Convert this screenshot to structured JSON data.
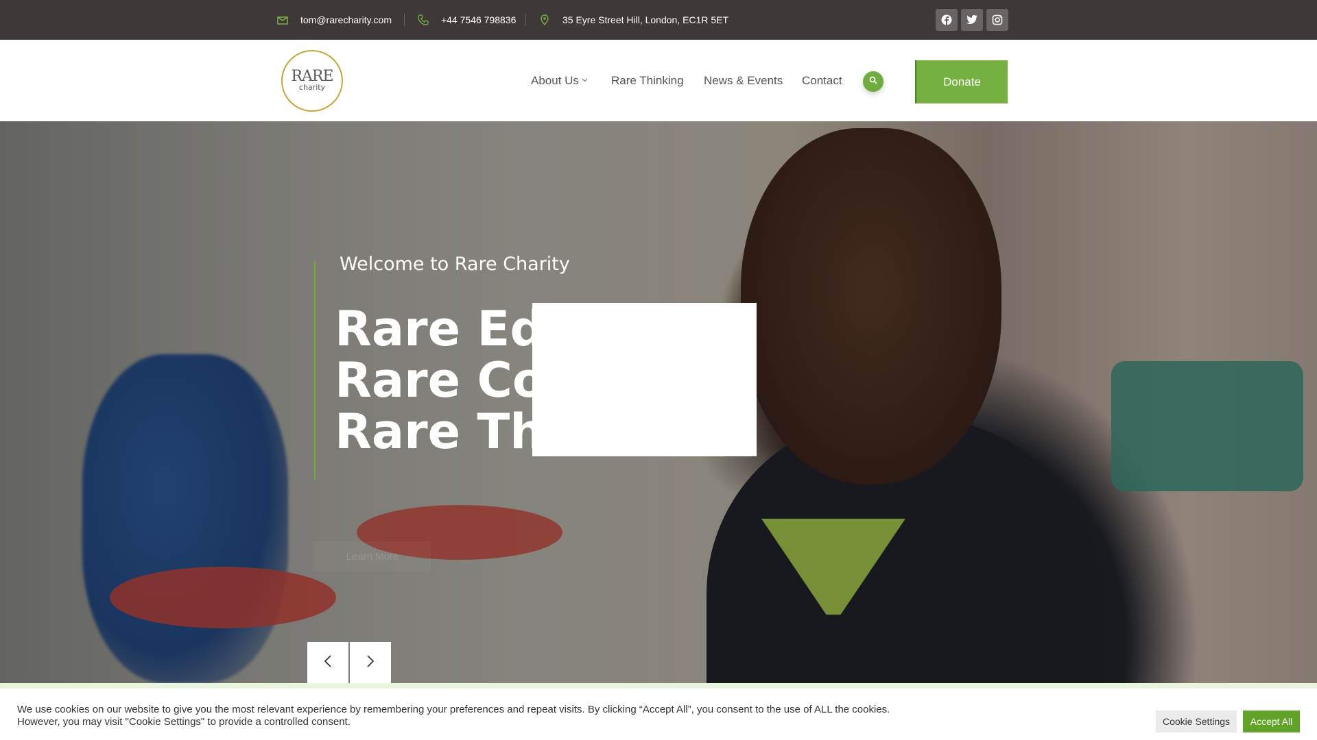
{
  "topbar": {
    "email": "tom@rarecharity.com",
    "phone": "+44 7546 798836",
    "address": "35 Eyre Street Hill, London, EC1R 5ET",
    "icons": [
      "envelope-icon",
      "phone-icon",
      "map-pin-icon"
    ],
    "social": [
      "facebook-icon",
      "twitter-icon",
      "instagram-icon"
    ]
  },
  "header": {
    "logo": {
      "line1": "RARE",
      "line2": "charity"
    },
    "nav": [
      {
        "label": "About Us",
        "has_dropdown": true
      },
      {
        "label": "Rare Thinking"
      },
      {
        "label": "News & Events"
      },
      {
        "label": "Contact"
      }
    ],
    "search_icon": "search-icon",
    "donate_label": "Donate"
  },
  "hero": {
    "welcome": "Welcome to Rare Charity",
    "headline_lines": [
      "Rare Edu",
      "Rare Co",
      "Rare Thi"
    ],
    "learn_more": "Learn More",
    "prev_icon": "chevron-left-icon",
    "next_icon": "chevron-right-icon"
  },
  "cookie": {
    "line1": "We use cookies on our website to give you the most relevant experience by remembering your preferences and repeat visits. By clicking “Accept All”, you consent to the use of ALL the cookies.",
    "line2": "However, you may visit \"Cookie Settings\" to provide a controlled consent.",
    "settings_label": "Cookie Settings",
    "accept_label": "Accept All"
  },
  "colors": {
    "topbar_bg": "#3e3838",
    "accent_green": "#76b041",
    "logo_gold": "#c8a63a"
  }
}
